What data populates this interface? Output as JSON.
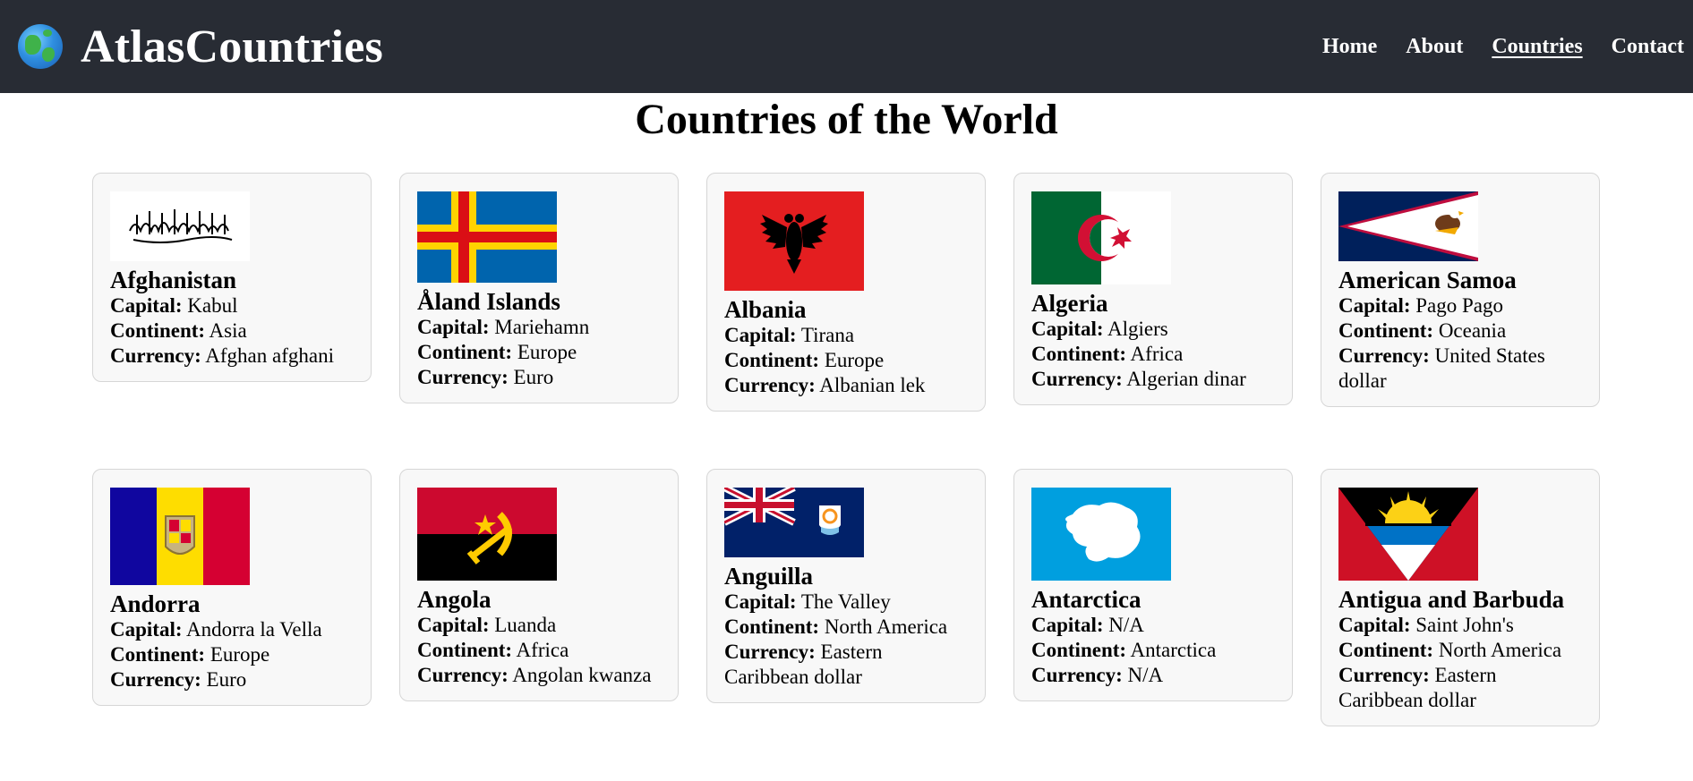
{
  "header": {
    "brand": "AtlasCountries",
    "nav": [
      {
        "label": "Home",
        "active": false
      },
      {
        "label": "About",
        "active": false
      },
      {
        "label": "Countries",
        "active": true
      },
      {
        "label": "Contact",
        "active": false
      }
    ]
  },
  "main": {
    "title": "Countries of the World",
    "labels": {
      "capital": "Capital:",
      "continent": "Continent:",
      "currency": "Currency:"
    },
    "countries": [
      {
        "name": "Afghanistan",
        "capital": "Kabul",
        "continent": "Asia",
        "currency": "Afghan afghani",
        "flag": "afghanistan-flag"
      },
      {
        "name": "Åland Islands",
        "capital": "Mariehamn",
        "continent": "Europe",
        "currency": "Euro",
        "flag": "aland-flag"
      },
      {
        "name": "Albania",
        "capital": "Tirana",
        "continent": "Europe",
        "currency": "Albanian lek",
        "flag": "albania-flag"
      },
      {
        "name": "Algeria",
        "capital": "Algiers",
        "continent": "Africa",
        "currency": "Algerian dinar",
        "flag": "algeria-flag"
      },
      {
        "name": "American Samoa",
        "capital": "Pago Pago",
        "continent": "Oceania",
        "currency": "United States dollar",
        "flag": "american-samoa-flag"
      },
      {
        "name": "Andorra",
        "capital": "Andorra la Vella",
        "continent": "Europe",
        "currency": "Euro",
        "flag": "andorra-flag"
      },
      {
        "name": "Angola",
        "capital": "Luanda",
        "continent": "Africa",
        "currency": "Angolan kwanza",
        "flag": "angola-flag"
      },
      {
        "name": "Anguilla",
        "capital": "The Valley",
        "continent": "North America",
        "currency": "Eastern Caribbean dollar",
        "flag": "anguilla-flag"
      },
      {
        "name": "Antarctica",
        "capital": "N/A",
        "continent": "Antarctica",
        "currency": "N/A",
        "flag": "antarctica-flag"
      },
      {
        "name": "Antigua and Barbuda",
        "capital": "Saint John's",
        "continent": "North America",
        "currency": "Eastern Caribbean dollar",
        "flag": "antigua-and-barbuda-flag"
      }
    ]
  },
  "colors": {
    "navbar_bg": "#282c34",
    "card_bg": "#f8f8f8",
    "card_border": "#d6d6d6"
  }
}
